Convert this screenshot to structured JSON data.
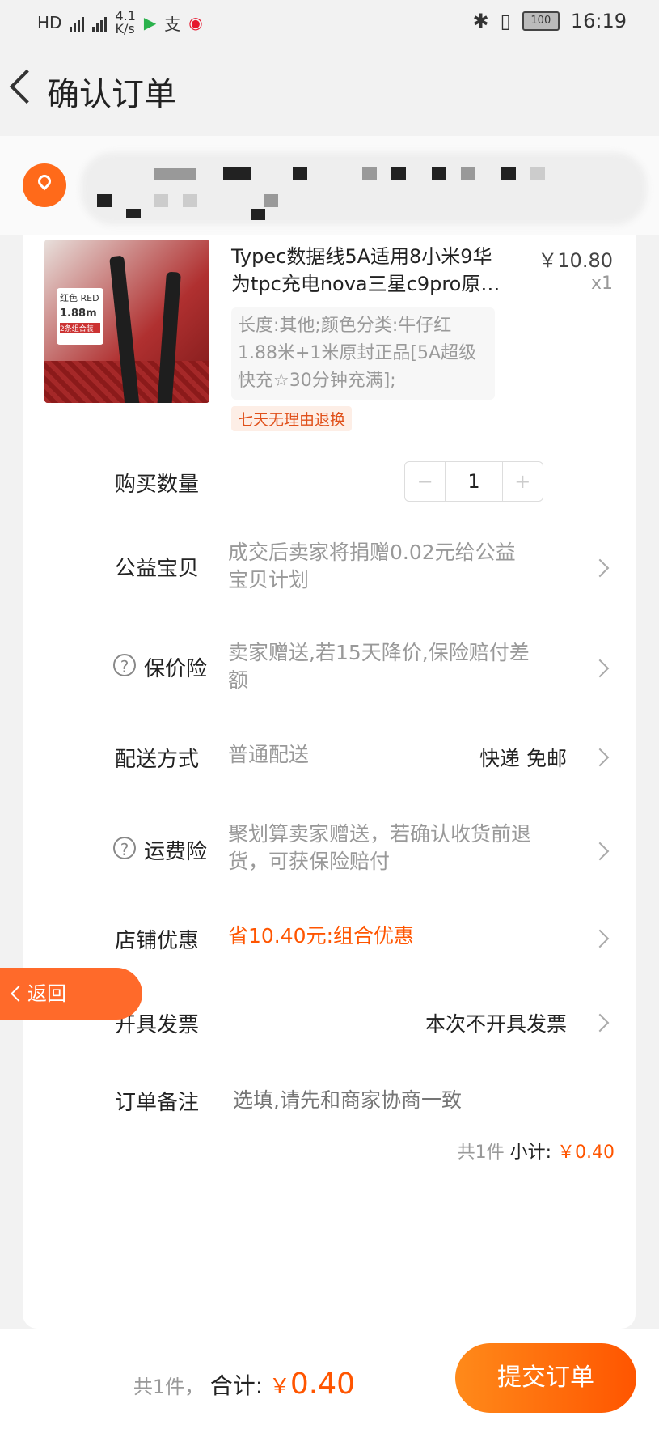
{
  "status_bar": {
    "network_labels": [
      "HD",
      "4G",
      "4G"
    ],
    "speed_value": "4.1",
    "speed_unit": "K/s",
    "battery": "100",
    "time": "16:19",
    "icons": [
      "hd-icon",
      "signal-icon",
      "signal-icon",
      "video-app-icon",
      "alipay-icon",
      "weibo-icon",
      "bluetooth-icon",
      "vibrate-icon",
      "battery-icon"
    ]
  },
  "header": {
    "title": "确认订单"
  },
  "product": {
    "title": "Typec数据线5A适用8小米9华为tpc充电nova三星c9pro原…",
    "price": "￥10.80",
    "quantity": "x1",
    "sku": "长度:其他;颜色分类:牛仔红1.88米+1米原封正品[5A超级快充☆30分钟充满];",
    "thumb_text": [
      "红色 RED",
      "1.88m",
      "2条组合装"
    ],
    "refund_tag": "七天无理由退换"
  },
  "rows": {
    "quantity": {
      "label": "购买数量",
      "minus": "−",
      "value": "1",
      "plus": "+"
    },
    "charity": {
      "label": "公益宝贝",
      "value": "成交后卖家将捐赠0.02元给公益宝贝计划"
    },
    "price_protect": {
      "label": "保价险",
      "value": "卖家赠送,若15天降价,保险赔付差额"
    },
    "delivery": {
      "label": "配送方式",
      "value": "普通配送",
      "right": "快递 免邮"
    },
    "shipping_ins": {
      "label": "运费险",
      "value": "聚划算卖家赠送，若确认收货前退货，可获保险赔付"
    },
    "store_discount": {
      "label": "店铺优惠",
      "value": "省10.40元:组合优惠"
    },
    "invoice": {
      "label": "开具发票",
      "right": "本次不开具发票"
    },
    "note": {
      "label": "订单备注",
      "placeholder": "选填,请先和商家协商一致"
    }
  },
  "subtotal": {
    "count": "共1件",
    "label": "小计:",
    "amount": "￥0.40"
  },
  "bottom": {
    "count": "共1件，",
    "label": "合计:",
    "currency": "￥",
    "amount": "0.40",
    "submit": "提交订单"
  },
  "float_back": "返回",
  "help_mark": "?"
}
